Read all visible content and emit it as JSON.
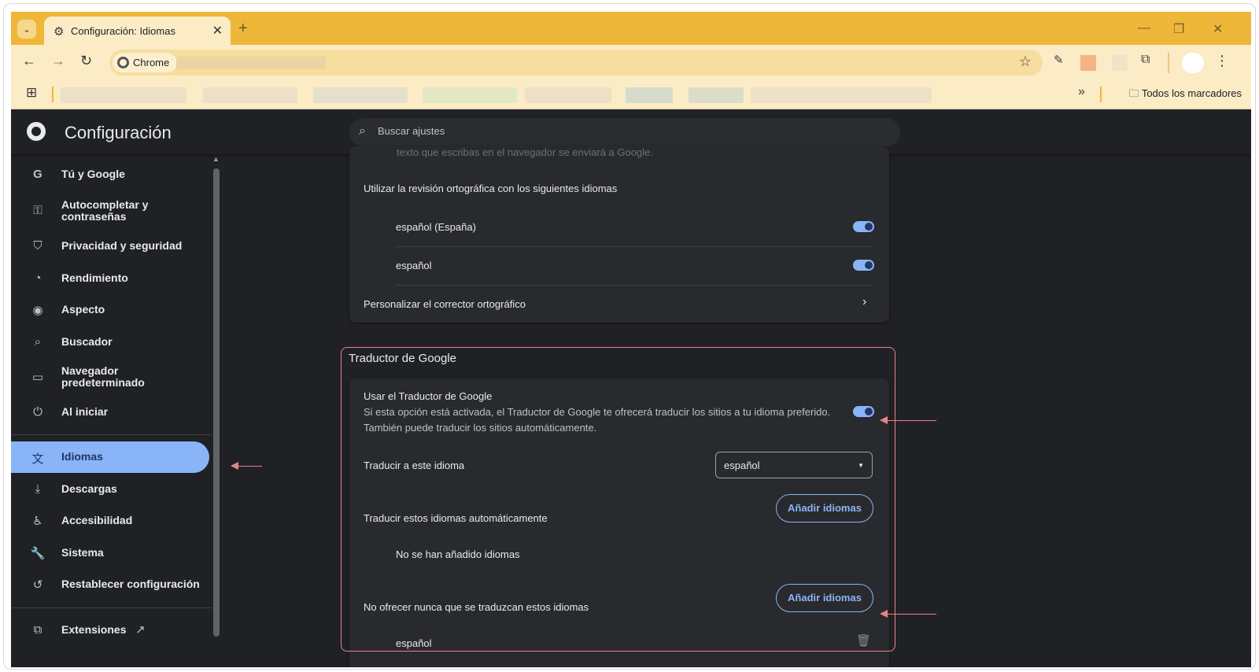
{
  "tab": {
    "title": "Configuración: Idiomas"
  },
  "toolbar": {
    "chip_label": "Chrome",
    "bookmarks_all": "Todos los marcadores"
  },
  "header": {
    "title": "Configuración",
    "search_placeholder": "Buscar ajustes"
  },
  "sidebar": {
    "items": [
      {
        "label": "Tú y Google",
        "icon": "google-g-icon"
      },
      {
        "label": "Autocompletar y contraseñas",
        "icon": "key-icon"
      },
      {
        "label": "Privacidad y seguridad",
        "icon": "shield-icon"
      },
      {
        "label": "Rendimiento",
        "icon": "speedometer-icon"
      },
      {
        "label": "Aspecto",
        "icon": "palette-icon"
      },
      {
        "label": "Buscador",
        "icon": "search-icon"
      },
      {
        "label": "Navegador predeterminado",
        "icon": "browser-window-icon"
      },
      {
        "label": "Al iniciar",
        "icon": "power-icon"
      },
      {
        "label": "Idiomas",
        "icon": "translate-icon"
      },
      {
        "label": "Descargas",
        "icon": "download-icon"
      },
      {
        "label": "Accesibilidad",
        "icon": "accessibility-icon"
      },
      {
        "label": "Sistema",
        "icon": "wrench-icon"
      },
      {
        "label": "Restablecer configuración",
        "icon": "reset-icon"
      },
      {
        "label": "Extensiones",
        "icon": "puzzle-icon"
      }
    ]
  },
  "spellcheck": {
    "cut_text": "texto que escribas en el navegador se enviará a Google.",
    "heading": "Utilizar la revisión ortográfica con los siguientes idiomas",
    "languages": [
      {
        "label": "español (España)",
        "enabled": true
      },
      {
        "label": "español",
        "enabled": true
      }
    ],
    "customize": "Personalizar el corrector ortográfico"
  },
  "translate": {
    "section_title": "Traductor de Google",
    "use_title": "Usar el Traductor de Google",
    "use_desc1": "Si esta opción está activada, el Traductor de Google te ofrecerá traducir los sitios a tu idioma preferido.",
    "use_desc2": "También puede traducir los sitios automáticamente.",
    "use_enabled": true,
    "target_label": "Traducir a este idioma",
    "target_value": "español",
    "auto_label": "Traducir estos idiomas automáticamente",
    "add_button": "Añadir idiomas",
    "auto_empty": "No se han añadido idiomas",
    "never_label": "No ofrecer nunca que se traduzcan estos idiomas",
    "never_languages": [
      "español"
    ]
  },
  "colors": {
    "accent": "#8ab4f8",
    "annotation": "#e8828a",
    "tabstrip": "#efb73a"
  }
}
